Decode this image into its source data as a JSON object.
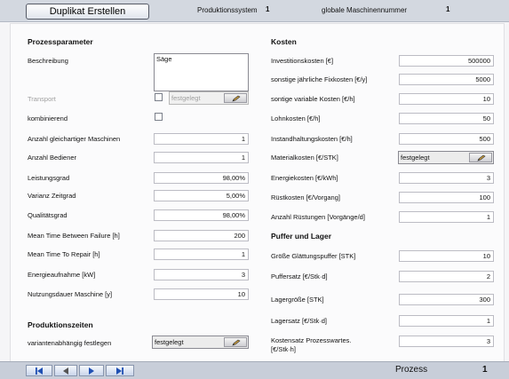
{
  "toolbar": {
    "duplicate_label": "Duplikat Erstellen",
    "system_label": "Produktionssystem",
    "system_value": "1",
    "machine_label": "globale Maschinennummer",
    "machine_value": "1"
  },
  "process": {
    "heading": "Prozessparameter",
    "description_label": "Beschreibung",
    "description_value": "Säge",
    "transport_label": "Transport",
    "transport_value": "festgelegt",
    "combining_label": "kombinierend",
    "machines_label": "Anzahl gleichartiger Maschinen",
    "machines_value": "1",
    "operators_label": "Anzahl Bediener",
    "operators_value": "1",
    "performance_label": "Leistungsgrad",
    "performance_value": "98,00%",
    "variance_label": "Varianz Zeitgrad",
    "variance_value": "5,00%",
    "quality_label": "Qualitätsgrad",
    "quality_value": "98,00%",
    "mtbf_label": "Mean Time Between Failure [h]",
    "mtbf_value": "200",
    "mttr_label": "Mean Time To Repair [h]",
    "mttr_value": "1",
    "energy_label": "Energieaufnahme [kW]",
    "energy_value": "3",
    "lifetime_label": "Nutzungsdauer Maschine [y]",
    "lifetime_value": "10"
  },
  "production_times": {
    "heading": "Produktionszeiten",
    "variant_label": "variantenabhängig festlegen",
    "variant_value": "festgelegt"
  },
  "costs": {
    "heading": "Kosten",
    "investment_label": "Investitionskosten [€]",
    "investment_value": "500000",
    "fixed_label": "sonstige jährliche Fixkosten [€/y]",
    "fixed_value": "5000",
    "variable_label": "sontige variable Kosten [€/h]",
    "variable_value": "10",
    "wage_label": "Lohnkosten [€/h]",
    "wage_value": "50",
    "maintenance_label": "Instandhaltungskosten [€/h]",
    "maintenance_value": "500",
    "material_label": "Materialkosten [€/STK]",
    "material_value": "festgelegt",
    "energy_cost_label": "Energiekosten [€/kWh]",
    "energy_cost_value": "3",
    "setup_label": "Rüstkosten [€/Vorgang]",
    "setup_value": "100",
    "setup_count_label": "Anzahl Rüstungen [Vorgänge/d]",
    "setup_count_value": "1"
  },
  "buffer": {
    "heading": "Puffer und Lager",
    "smoothing_label": "Größe Glättungspuffer [STK]",
    "smoothing_value": "10",
    "buffer_rate_label": "Puffersatz [€/Stk·d]",
    "buffer_rate_value": "2",
    "storage_size_label": "Lagergröße [STK]",
    "storage_size_value": "300",
    "storage_rate_label": "Lagersatz [€/Stk·d]",
    "storage_rate_value": "1",
    "waiting_label_1": "Kostensatz Prozesswartes.",
    "waiting_label_2": "[€/Stk·h]",
    "waiting_value": "3"
  },
  "status": {
    "label": "Prozess",
    "value": "1"
  },
  "icons": {
    "first": "first-record-icon",
    "prev": "previous-record-icon",
    "next": "next-record-icon",
    "last": "last-record-icon",
    "edit": "pencil-icon"
  }
}
